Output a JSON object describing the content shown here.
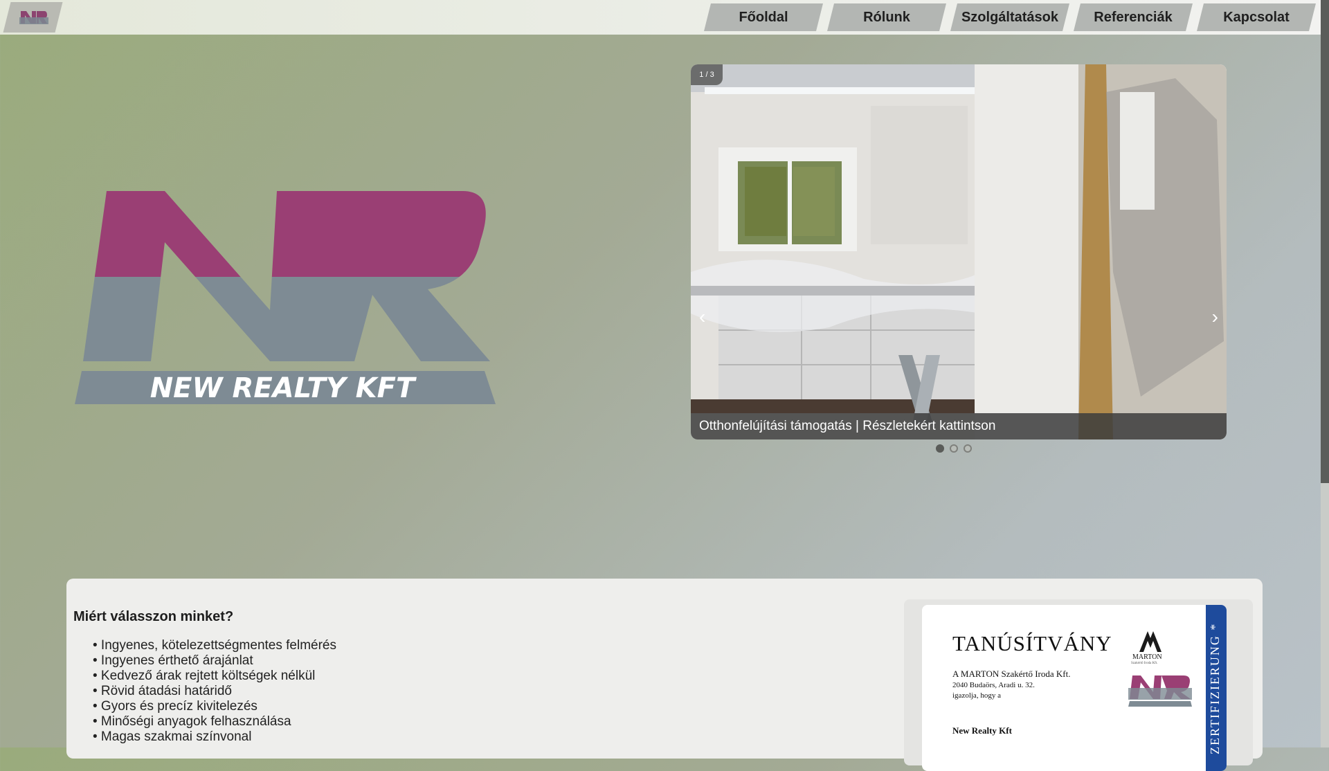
{
  "brand": {
    "logo_text": "NEW REALTY KFT",
    "mini_logo": "NR"
  },
  "nav": {
    "items": [
      {
        "label": "Főoldal"
      },
      {
        "label": "Rólunk"
      },
      {
        "label": "Szolgáltatások"
      },
      {
        "label": "Referenciák"
      },
      {
        "label": "Kapcsolat"
      }
    ]
  },
  "carousel": {
    "counter": "1 / 3",
    "caption": "Otthonfelújítási támogatás | Részletekért kattintson",
    "prev_icon": "‹",
    "next_icon": "›",
    "slides": 3,
    "active_slide": 1
  },
  "content": {
    "why_title": "Miért válasszon minket?",
    "reasons": [
      "• Ingyenes, kötelezettségmentes felmérés",
      "• Ingyenes érthető árajánlat",
      "• Kedvező árak rejtett költségek nélkül",
      "• Rövid átadási határidő",
      "• Gyors és precíz kivitelezés",
      "• Minőségi anyagok felhasználása",
      "• Magas szakmai színvonal"
    ]
  },
  "certificate": {
    "title": "TANÚSÍTVÁNY",
    "issuer": "A MARTON Szakértő Iroda Kft.",
    "address": "2040 Budaörs, Aradi u. 32.",
    "text": "igazolja, hogy a",
    "company": "New Realty Kft",
    "band_text": "ZERTIFIZIERUNG *",
    "marton_name": "MARTON",
    "marton_sub": "Szakértő Iroda Kft."
  },
  "colors": {
    "brand_magenta": "#9a3f74",
    "brand_gray": "#7e8b94",
    "cert_blue": "#1e4b9c"
  }
}
